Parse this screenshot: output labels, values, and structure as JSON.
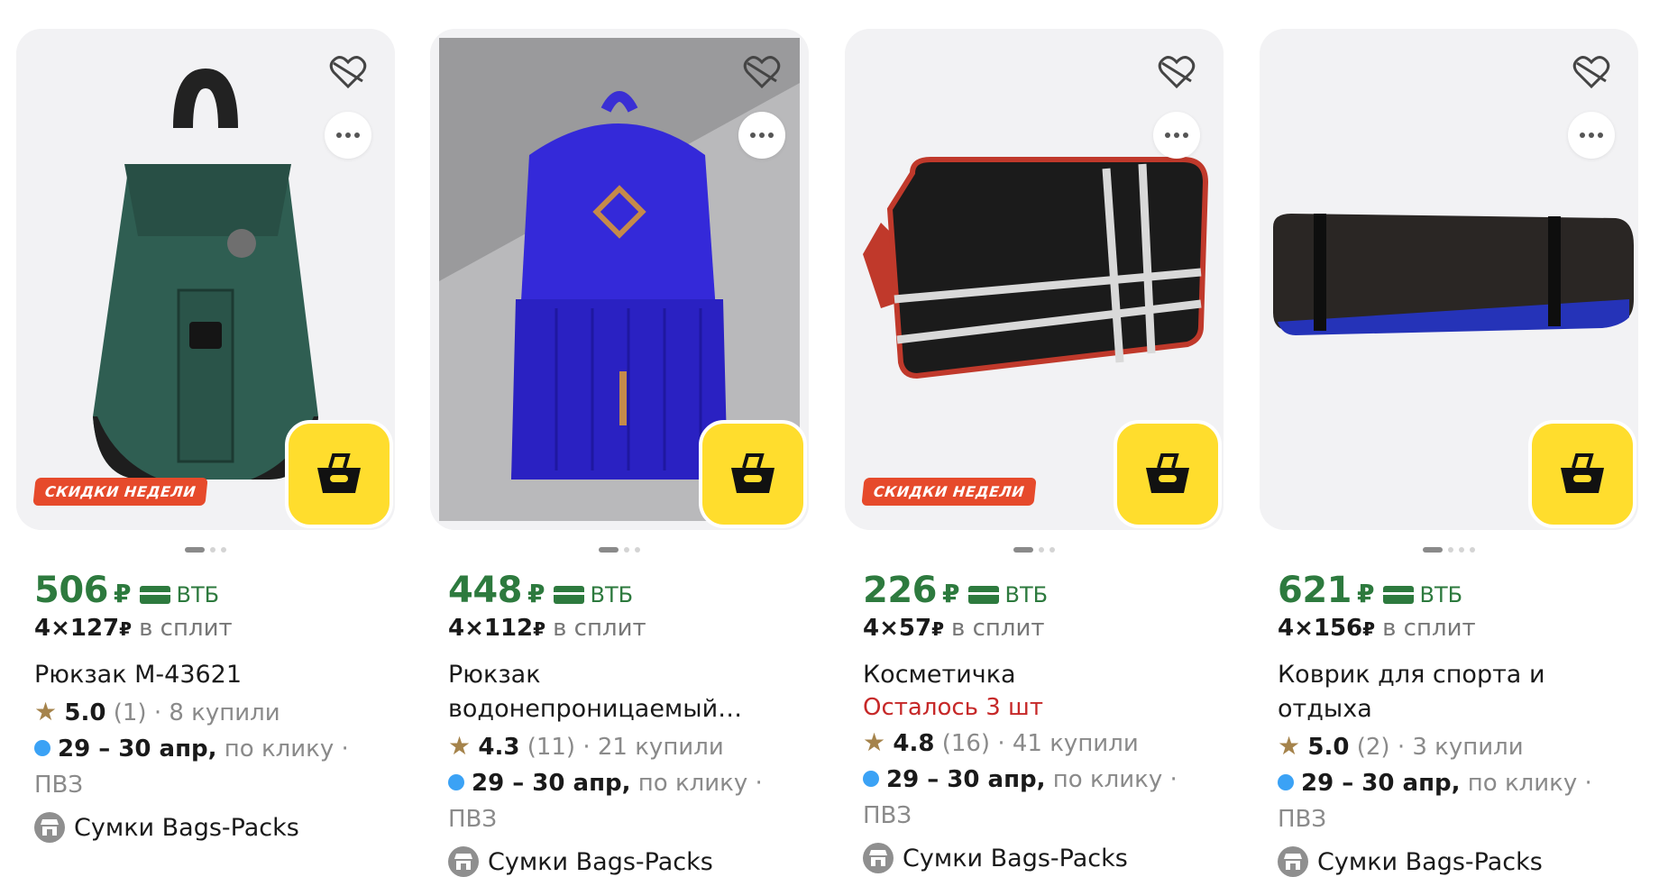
{
  "colors": {
    "price_green": "#2d7a3e",
    "badge_red": "#e64a2b",
    "cart_yellow": "#ffdd2d",
    "stock_red": "#c62828",
    "delivery_blue": "#3ba2f5",
    "star": "#a5834b"
  },
  "icons": {
    "favorite": "heart-crossed-icon",
    "more": "more-dots-icon",
    "cart": "basket-icon",
    "shop": "shop-icon",
    "star": "star-icon"
  },
  "products": [
    {
      "badge": "СКИДКИ НЕДЕЛИ",
      "price": "506",
      "currency": "₽",
      "pay_label": "ВТБ",
      "split_amount": "4×127",
      "split_currency": "₽",
      "split_label": "в сплит",
      "title": "Рюкзак М-43621",
      "stock": "",
      "rating_star": "★",
      "rating": "5.0",
      "reviews": "(1)",
      "bought": "· 8 купили",
      "delivery_date": "29 – 30 апр,",
      "delivery_click": "по клику",
      "delivery_pvz": "· ПВЗ",
      "shop": "Сумки Bags-Packs"
    },
    {
      "badge": "",
      "price": "448",
      "currency": "₽",
      "pay_label": "ВТБ",
      "split_amount": "4×112",
      "split_currency": "₽",
      "split_label": "в сплит",
      "title": "Рюкзак водонепроницаемый…",
      "stock": "",
      "rating_star": "★",
      "rating": "4.3",
      "reviews": "(11)",
      "bought": "· 21 купили",
      "delivery_date": "29 – 30 апр,",
      "delivery_click": "по клику",
      "delivery_pvz": "· ПВЗ",
      "shop": "Сумки Bags-Packs"
    },
    {
      "badge": "СКИДКИ НЕДЕЛИ",
      "price": "226",
      "currency": "₽",
      "pay_label": "ВТБ",
      "split_amount": "4×57",
      "split_currency": "₽",
      "split_label": "в сплит",
      "title": "Косметичка",
      "stock": "Осталось 3 шт",
      "rating_star": "★",
      "rating": "4.8",
      "reviews": "(16)",
      "bought": "· 41 купили",
      "delivery_date": "29 – 30 апр,",
      "delivery_click": "по клику",
      "delivery_pvz": "· ПВЗ",
      "shop": "Сумки Bags-Packs"
    },
    {
      "badge": "",
      "price": "621",
      "currency": "₽",
      "pay_label": "ВТБ",
      "split_amount": "4×156",
      "split_currency": "₽",
      "split_label": "в сплит",
      "title": "Коврик для спорта и отдыха",
      "stock": "",
      "rating_star": "★",
      "rating": "5.0",
      "reviews": "(2)",
      "bought": "· 3 купили",
      "delivery_date": "29 – 30 апр,",
      "delivery_click": "по клику",
      "delivery_pvz": "· ПВЗ",
      "shop": "Сумки Bags-Packs"
    }
  ]
}
